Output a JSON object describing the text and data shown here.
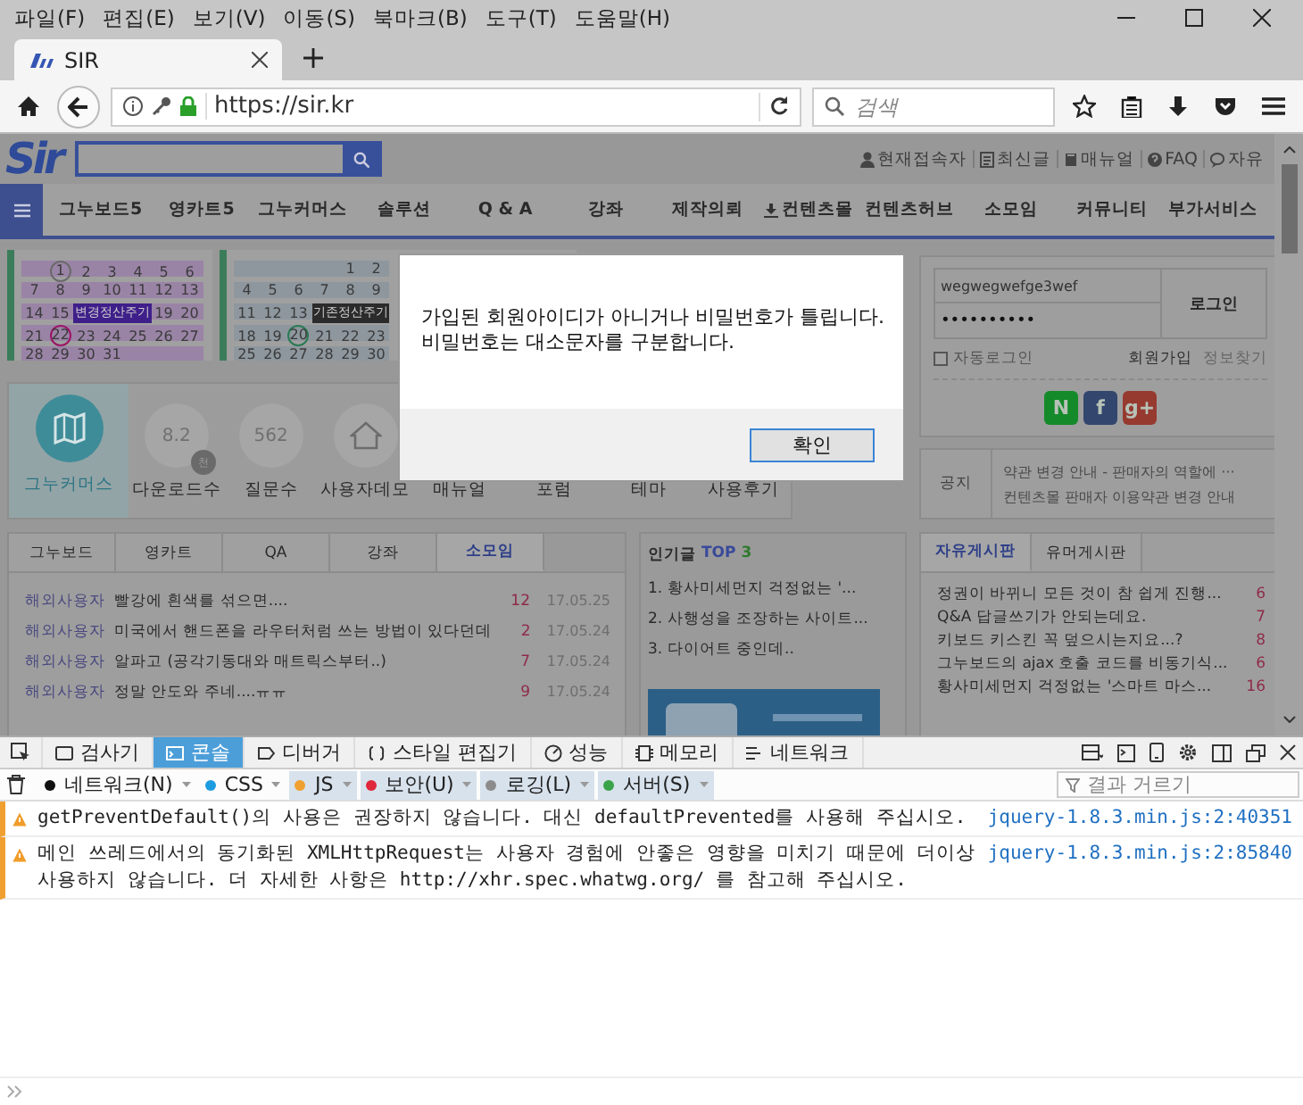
{
  "menubar": {
    "menus": [
      "파일(F)",
      "편집(E)",
      "보기(V)",
      "이동(S)",
      "북마크(B)",
      "도구(T)",
      "도움말(H)"
    ]
  },
  "tab": {
    "title": "SIR",
    "selected": true
  },
  "address_bar": {
    "url": "https://sir.kr"
  },
  "search_box": {
    "placeholder": "검색"
  },
  "site": {
    "logo": "Sir",
    "top_links": [
      {
        "kind": "user",
        "label": "현재접속자"
      },
      {
        "kind": "document",
        "label": "최신글"
      },
      {
        "kind": "book",
        "label": "매뉴얼"
      },
      {
        "kind": "help",
        "label": "FAQ"
      },
      {
        "kind": "chat",
        "label": "자유"
      }
    ],
    "nav": [
      {
        "kind": "text",
        "label": "그누보드5"
      },
      {
        "kind": "text",
        "label": "영카트5"
      },
      {
        "kind": "text",
        "label": "그누커머스"
      },
      {
        "kind": "text",
        "label": "솔루션"
      },
      {
        "kind": "text",
        "label": "Q & A"
      },
      {
        "kind": "text",
        "label": "강좌"
      },
      {
        "kind": "text",
        "label": "제작의뢰"
      },
      {
        "kind": "download",
        "label": "컨텐츠몰"
      },
      {
        "kind": "text",
        "label": "컨텐츠허브"
      },
      {
        "kind": "text",
        "label": "소모임"
      },
      {
        "kind": "text",
        "label": "커뮤니티"
      },
      {
        "kind": "text",
        "label": "부가서비스"
      }
    ],
    "calendars": [
      {
        "weeks": [
          [
            {
              "kind": "circled",
              "text": "1",
              "color": "#6a6a6a"
            },
            "2",
            "3",
            "4",
            "5",
            "6"
          ],
          [
            "7",
            "8",
            "9",
            "10",
            "11",
            "12",
            "13"
          ],
          [
            "14",
            "15",
            {
              "kind": "tooltip",
              "text": "변경정산주기",
              "color": "#3f1f8a"
            },
            "19",
            "20"
          ],
          [
            "21",
            {
              "kind": "circled",
              "text": "22",
              "color": "#9c1466"
            },
            "23",
            "24",
            "25",
            "26",
            "27"
          ],
          [
            "28",
            "29",
            "30",
            "31"
          ]
        ]
      },
      {
        "weeks": [
          [
            "1",
            "2"
          ],
          [
            "4",
            "5",
            "6",
            "7",
            "8",
            "9"
          ],
          [
            "11",
            "12",
            "13",
            {
              "kind": "tooltip",
              "text": "기존정산주기",
              "color": "#2b2b2b"
            }
          ],
          [
            "18",
            "19",
            {
              "kind": "circled",
              "text": "20",
              "color": "#2a7a52"
            },
            "21",
            "22",
            "23"
          ],
          [
            "25",
            "26",
            "27",
            "28",
            "29",
            "30"
          ]
        ]
      }
    ],
    "stats": [
      {
        "kind": "brand",
        "label": "그누커머스"
      },
      {
        "kind": "number",
        "value": "8.2",
        "badge": "천",
        "label": "다운로드수"
      },
      {
        "kind": "number",
        "value": "562",
        "label": "질문수"
      },
      {
        "kind": "house",
        "label": "사용자데모"
      },
      {
        "kind": "plain",
        "label": "매뉴얼"
      },
      {
        "kind": "plain",
        "label": "포럼"
      },
      {
        "kind": "plain",
        "label": "테마"
      },
      {
        "kind": "plain",
        "label": "사용후기"
      }
    ],
    "login": {
      "user_id": "wegwegwefge3wef",
      "password": "••••••••••",
      "button": "로그인",
      "auto_login": {
        "label": "자동로그인",
        "checked": false
      },
      "links": [
        "회원가입",
        "정보찾기"
      ],
      "social": [
        {
          "label": "N",
          "color": "#158a2a"
        },
        {
          "label": "f",
          "color": "#33466e"
        },
        {
          "label": "g+",
          "color": "#963a30"
        }
      ]
    },
    "notice": {
      "label": "공지",
      "items": [
        "약관 변경 안내 - 판매자의 역할에 ···",
        "컨텐츠몰 판매자 이용약관 변경 안내"
      ]
    },
    "board": {
      "tabs": [
        {
          "label": "그누보드",
          "selected": false
        },
        {
          "label": "영카트",
          "selected": false
        },
        {
          "label": "QA",
          "selected": false
        },
        {
          "label": "강좌",
          "selected": false
        },
        {
          "label": "소모임",
          "selected": true
        }
      ],
      "rows": [
        {
          "author": "해외사용자",
          "title": "빨강에 흰색를 섞으면....",
          "count": "12",
          "date": "17.05.25"
        },
        {
          "author": "해외사용자",
          "title": "미국에서 핸드폰을 라우터처럼 쓰는 방법이 있다던데",
          "count": "2",
          "date": "17.05.24"
        },
        {
          "author": "해외사용자",
          "title": "알파고 (공각기동대와 매트릭스부터..)",
          "count": "7",
          "date": "17.05.24"
        },
        {
          "author": "해외사용자",
          "title": "정말 안도와 주네....ㅠㅠ",
          "count": "9",
          "date": "17.05.24"
        }
      ]
    },
    "popular": {
      "title": "인기글",
      "top": "TOP",
      "rank": "3",
      "items": [
        "1. 황사미세먼지 걱정없는 '...",
        "2. 사행성을 조장하는 사이트...",
        "3. 다이어트 중인데.."
      ]
    },
    "free_board": {
      "tabs": [
        {
          "label": "자유게시판",
          "selected": true
        },
        {
          "label": "유머게시판",
          "selected": false
        }
      ],
      "rows": [
        {
          "title": "정권이 바뀌니 모든 것이 참 쉽게 진행...",
          "count": "6"
        },
        {
          "title": "Q&A 답글쓰기가 안되는데요.",
          "count": "7"
        },
        {
          "title": "키보드 키스킨 꼭 덮으시는지요...?",
          "count": "8"
        },
        {
          "title": "그누보드의 ajax 호출 코드를 비동기식...",
          "count": "6"
        },
        {
          "title": "황사미세먼지 걱정없는 '스마트 마스...",
          "count": "16"
        }
      ]
    }
  },
  "dialog": {
    "lines": [
      "가입된 회원아이디가 아니거나 비밀번호가 틀립니다.",
      "비밀번호는 대소문자를 구분합니다."
    ],
    "button": "확인"
  },
  "devtools": {
    "tabs": [
      {
        "kind": "inspector",
        "label": "검사기",
        "selected": false
      },
      {
        "kind": "console",
        "label": "콘솔",
        "selected": true
      },
      {
        "kind": "debugger",
        "label": "디버거",
        "selected": false
      },
      {
        "kind": "style",
        "label": "스타일 편집기",
        "selected": false
      },
      {
        "kind": "performance",
        "label": "성능",
        "selected": false
      },
      {
        "kind": "memory",
        "label": "메모리",
        "selected": false
      },
      {
        "kind": "network",
        "label": "네트워크",
        "selected": false
      }
    ],
    "filters": [
      {
        "label": "네트워크(N)",
        "color": "#111111",
        "on": false
      },
      {
        "label": "CSS",
        "color": "#1d9be0",
        "on": false
      },
      {
        "label": "JS",
        "color": "#f0a030",
        "on": true
      },
      {
        "label": "보안(U)",
        "color": "#e0283c",
        "on": true
      },
      {
        "label": "로깅(L)",
        "color": "#8c8c8c",
        "on": true
      },
      {
        "label": "서버(S)",
        "color": "#3aa34a",
        "on": true
      }
    ],
    "filter_field": {
      "placeholder": "결과 거르기"
    },
    "messages": [
      {
        "kind": "warning",
        "text": "getPreventDefault()의 사용은 권장하지 않습니다. 대신 defaultPrevented를 사용해 주십시오.",
        "source": "jquery-1.8.3.min.js:2:40351"
      },
      {
        "kind": "warning",
        "text": "메인 쓰레드에서의 동기화된 XMLHttpRequest는 사용자 경험에 안좋은 영향을 미치기 때문에 더이상 사용하지 않습니다. 더 자세한 사항은 http://xhr.spec.whatwg.org/ 를 참고해 주십시오.",
        "source": "jquery-1.8.3.min.js:2:85840"
      }
    ]
  }
}
